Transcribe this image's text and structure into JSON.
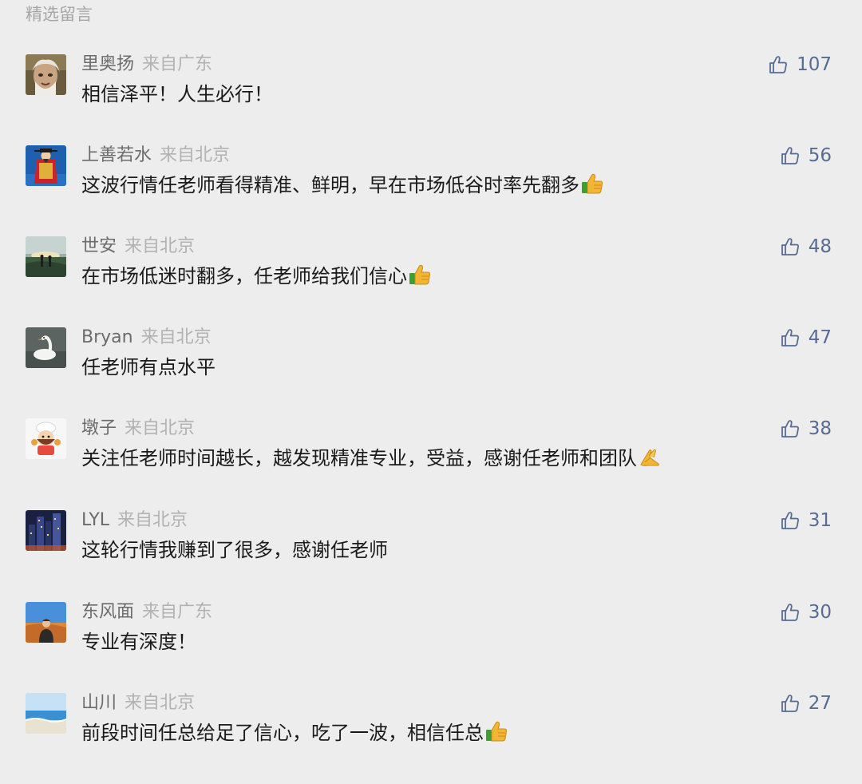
{
  "section": {
    "title": "精选留言"
  },
  "comments": [
    {
      "name": "里奥扬",
      "location": "来自广东",
      "text": "相信泽平！人生必行！",
      "likes": "107",
      "emoji": ""
    },
    {
      "name": "上善若水",
      "location": "来自北京",
      "text": "这波行情任老师看得精准、鲜明，早在市场低谷时率先翻多",
      "likes": "56",
      "emoji": "thumbs-up"
    },
    {
      "name": "世安",
      "location": "来自北京",
      "text": "在市场低迷时翻多，任老师给我们信心",
      "likes": "48",
      "emoji": "thumbs-up"
    },
    {
      "name": "Bryan",
      "location": "来自北京",
      "text": "任老师有点水平",
      "likes": "47",
      "emoji": ""
    },
    {
      "name": "墩子",
      "location": "来自北京",
      "text": "关注任老师时间越长，越发现精准专业，受益，感谢任老师和团队",
      "likes": "38",
      "emoji": "folded-hands"
    },
    {
      "name": "LYL",
      "location": "来自北京",
      "text": "这轮行情我赚到了很多，感谢任老师",
      "likes": "31",
      "emoji": ""
    },
    {
      "name": "东风面",
      "location": "来自广东",
      "text": "专业有深度！",
      "likes": "30",
      "emoji": ""
    },
    {
      "name": "山川",
      "location": "来自北京",
      "text": "前段时间任总给足了信心，吃了一波，相信任总",
      "likes": "27",
      "emoji": "thumbs-up"
    }
  ],
  "colors": {
    "background": "#ededed",
    "nickname": "#6b6b6b",
    "location": "#b2b2b2",
    "content": "#1a1a1a",
    "like": "#576b95",
    "section_title": "#a6a6a6"
  },
  "icons": {
    "like": "thumb-up-outline-icon",
    "avatars": [
      "old-man-portrait",
      "deity-figure-illustration",
      "sunset-walkers-photo",
      "swan-on-water-photo",
      "chef-cartoon",
      "night-city-photo",
      "desert-portrait-photo",
      "beach-waves-photo"
    ]
  }
}
